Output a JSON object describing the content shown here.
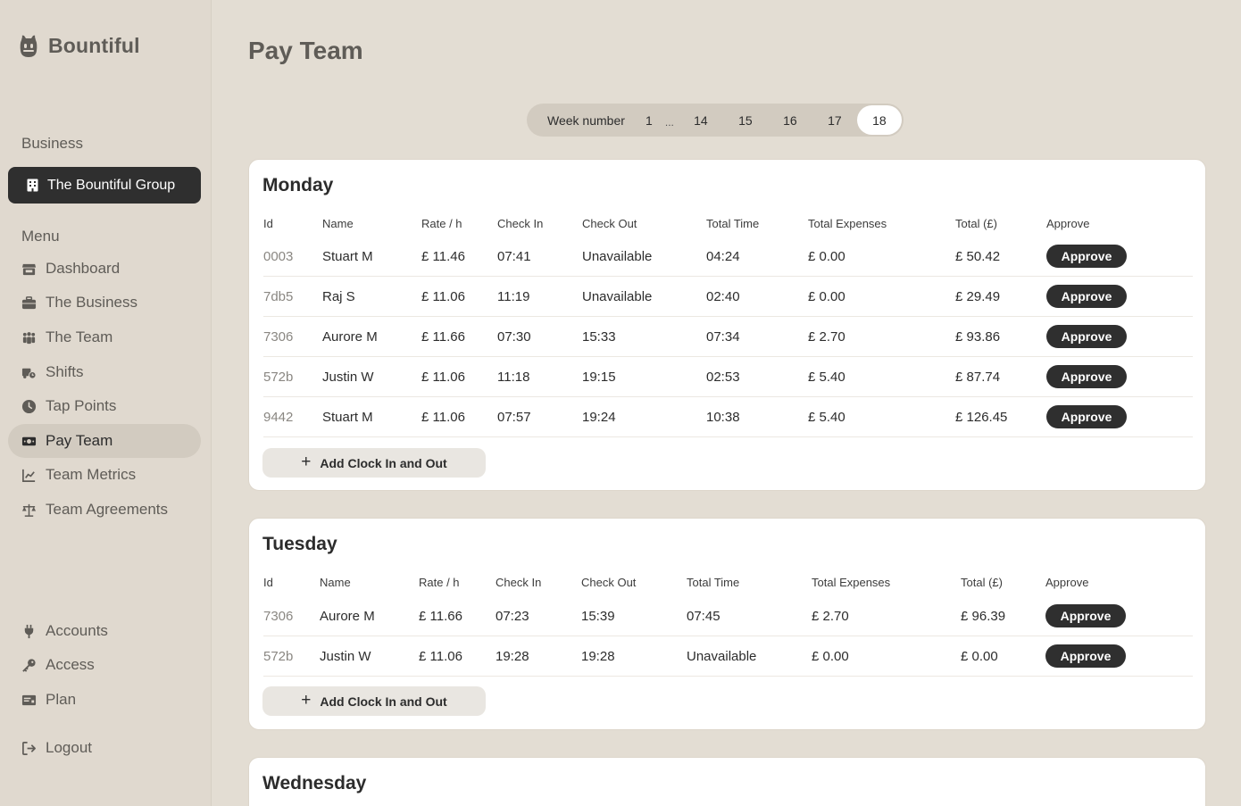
{
  "app": {
    "name": "Bountiful"
  },
  "sidebar": {
    "business_label": "Business",
    "business_name": "The Bountiful Group",
    "menu_label": "Menu",
    "menu": [
      {
        "label": "Dashboard",
        "icon": "store-icon"
      },
      {
        "label": "The Business",
        "icon": "briefcase-icon"
      },
      {
        "label": "The Team",
        "icon": "people-icon"
      },
      {
        "label": "Shifts",
        "icon": "truck-clock-icon"
      },
      {
        "label": "Tap Points",
        "icon": "clock-icon"
      },
      {
        "label": "Pay Team",
        "icon": "money-icon",
        "active": true
      },
      {
        "label": "Team Metrics",
        "icon": "chart-line-icon"
      },
      {
        "label": "Team Agreements",
        "icon": "scale-icon"
      }
    ],
    "bottom": [
      {
        "label": "Accounts",
        "icon": "plug-icon"
      },
      {
        "label": "Access",
        "icon": "key-icon"
      },
      {
        "label": "Plan",
        "icon": "card-icon"
      }
    ],
    "logout": "Logout"
  },
  "page": {
    "title": "Pay Team"
  },
  "weeks": {
    "label": "Week number",
    "first": "1",
    "ellipsis": "...",
    "items": [
      "14",
      "15",
      "16",
      "17",
      "18"
    ],
    "active": "18"
  },
  "columns": {
    "id": "Id",
    "name": "Name",
    "rate": "Rate / h",
    "check_in": "Check In",
    "check_out": "Check Out",
    "total_time": "Total Time",
    "total_expenses": "Total Expenses",
    "total": "Total (£)",
    "approve": "Approve"
  },
  "approve_label": "Approve",
  "add_label": "Add Clock In and Out",
  "days": [
    {
      "name": "Monday",
      "rows": [
        {
          "id": "0003",
          "name": "Stuart M",
          "rate": "£ 11.46",
          "check_in": "07:41",
          "check_out": "Unavailable",
          "total_time": "04:24",
          "expenses": "£ 0.00",
          "total": "£ 50.42"
        },
        {
          "id": "7db5",
          "name": "Raj S",
          "rate": "£ 11.06",
          "check_in": "11:19",
          "check_out": "Unavailable",
          "total_time": "02:40",
          "expenses": "£ 0.00",
          "total": "£ 29.49"
        },
        {
          "id": "7306",
          "name": "Aurore M",
          "rate": "£ 11.66",
          "check_in": "07:30",
          "check_out": "15:33",
          "total_time": "07:34",
          "expenses": "£ 2.70",
          "total": "£ 93.86"
        },
        {
          "id": "572b",
          "name": "Justin W",
          "rate": "£ 11.06",
          "check_in": "11:18",
          "check_out": "19:15",
          "total_time": "02:53",
          "expenses": "£ 5.40",
          "total": "£ 87.74"
        },
        {
          "id": "9442",
          "name": "Stuart M",
          "rate": "£ 11.06",
          "check_in": "07:57",
          "check_out": "19:24",
          "total_time": "10:38",
          "expenses": "£ 5.40",
          "total": "£ 126.45"
        }
      ]
    },
    {
      "name": "Tuesday",
      "rows": [
        {
          "id": "7306",
          "name": "Aurore M",
          "rate": "£ 11.66",
          "check_in": "07:23",
          "check_out": "15:39",
          "total_time": "07:45",
          "expenses": "£ 2.70",
          "total": "£ 96.39"
        },
        {
          "id": "572b",
          "name": "Justin W",
          "rate": "£ 11.06",
          "check_in": "19:28",
          "check_out": "19:28",
          "total_time": "Unavailable",
          "expenses": "£ 0.00",
          "total": "£ 0.00"
        }
      ]
    },
    {
      "name": "Wednesday",
      "rows": []
    }
  ]
}
